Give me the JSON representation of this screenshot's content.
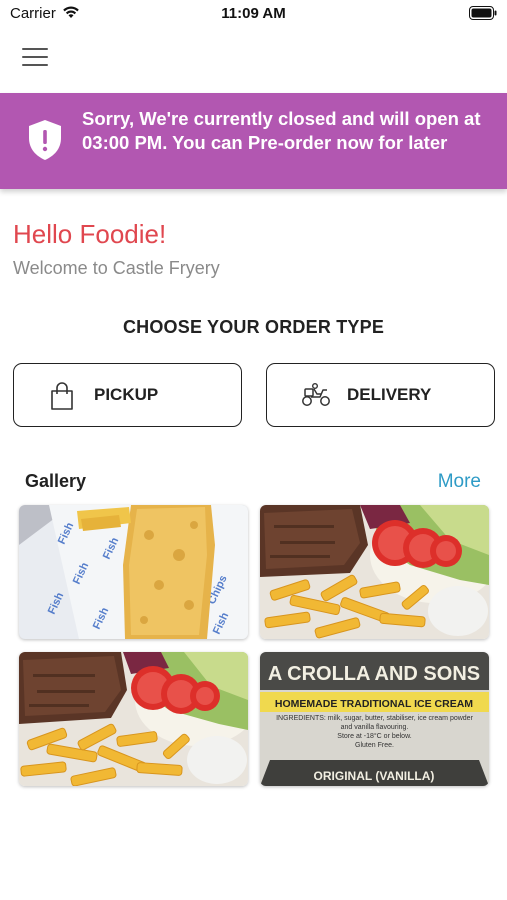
{
  "status_bar": {
    "carrier": "Carrier",
    "time": "11:09 AM"
  },
  "banner": {
    "message": "Sorry, We're currently closed and will open at 03:00 PM. You can Pre-order now for later",
    "color": "#b257b1"
  },
  "greeting": {
    "title": "Hello Foodie!",
    "subtitle": "Welcome to Castle Fryery"
  },
  "order_type": {
    "heading": "CHOOSE YOUR ORDER TYPE",
    "pickup_label": "PICKUP",
    "pickup_icon": "shopping-bag-icon",
    "delivery_label": "DELIVERY",
    "delivery_icon": "scooter-icon"
  },
  "gallery": {
    "title": "Gallery",
    "more_label": "More",
    "images": [
      {
        "name": "fish-in-paper-photo"
      },
      {
        "name": "steak-salad-chips-photo"
      },
      {
        "name": "steak-salad-chips-photo-2"
      },
      {
        "name": "ice-cream-label-photo",
        "brand": "A CROLLA AND SONS",
        "tagline": "HOMEMADE TRADITIONAL ICE CREAM",
        "ingredients": "INGREDIENTS: milk, sugar, butter, stabiliser, ice cream powder and vanilla flavouring.",
        "storage": "Store at -18°C or below.",
        "gluten": "Gluten Free.",
        "flavour": "ORIGINAL (VANILLA)"
      }
    ]
  },
  "colors": {
    "accent_red": "#e0474f",
    "link_blue": "#2e9bc6"
  }
}
